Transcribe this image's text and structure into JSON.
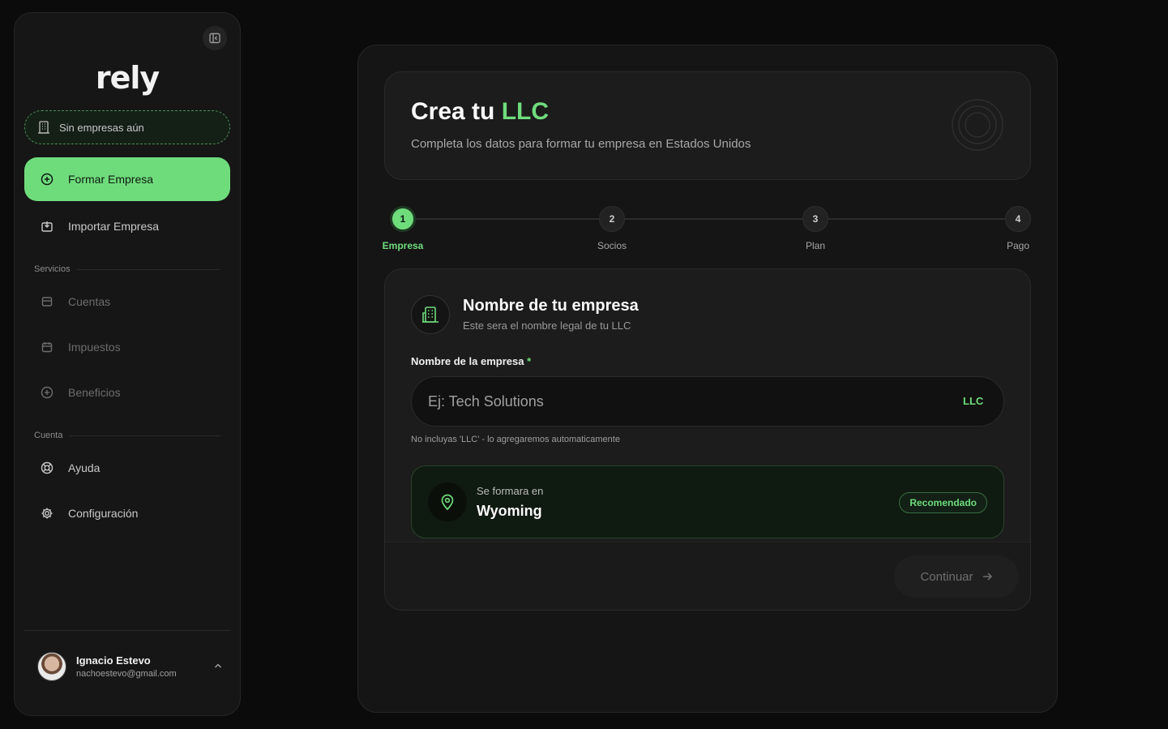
{
  "sidebar": {
    "logo": "rely",
    "no_company": "Sin empresas aún",
    "primary_item": "Formar Empresa",
    "import_item": "Importar Empresa",
    "section_services": "Servicios",
    "services": [
      "Cuentas",
      "Impuestos",
      "Beneficios"
    ],
    "section_account": "Cuenta",
    "account_items": [
      "Ayuda",
      "Configuración"
    ],
    "user": {
      "name": "Ignacio Estevo",
      "email": "nachoestevo@gmail.com"
    }
  },
  "hero": {
    "title_prefix": "Crea tu",
    "title_accent": "LLC",
    "subtitle": "Completa los datos para formar tu empresa en Estados Unidos"
  },
  "steps": [
    {
      "number": "1",
      "label": "Empresa",
      "active": true
    },
    {
      "number": "2",
      "label": "Socios",
      "active": false
    },
    {
      "number": "3",
      "label": "Plan",
      "active": false
    },
    {
      "number": "4",
      "label": "Pago",
      "active": false
    }
  ],
  "form": {
    "title": "Nombre de tu empresa",
    "subtitle": "Este sera el nombre legal de tu LLC",
    "field_label": "Nombre de la empresa",
    "required_mark": "*",
    "placeholder": "Ej: Tech Solutions",
    "value": "",
    "suffix": "LLC",
    "hint": "No incluyas 'LLC' - lo agregaremos automaticamente",
    "state_prefix": "Se formara en",
    "state_name": "Wyoming",
    "state_badge": "Recomendado",
    "continue_label": "Continuar"
  },
  "colors": {
    "accent": "#6fdc7c",
    "background": "#0b0b0b",
    "panel": "#151515",
    "card": "#1c1c1c"
  }
}
